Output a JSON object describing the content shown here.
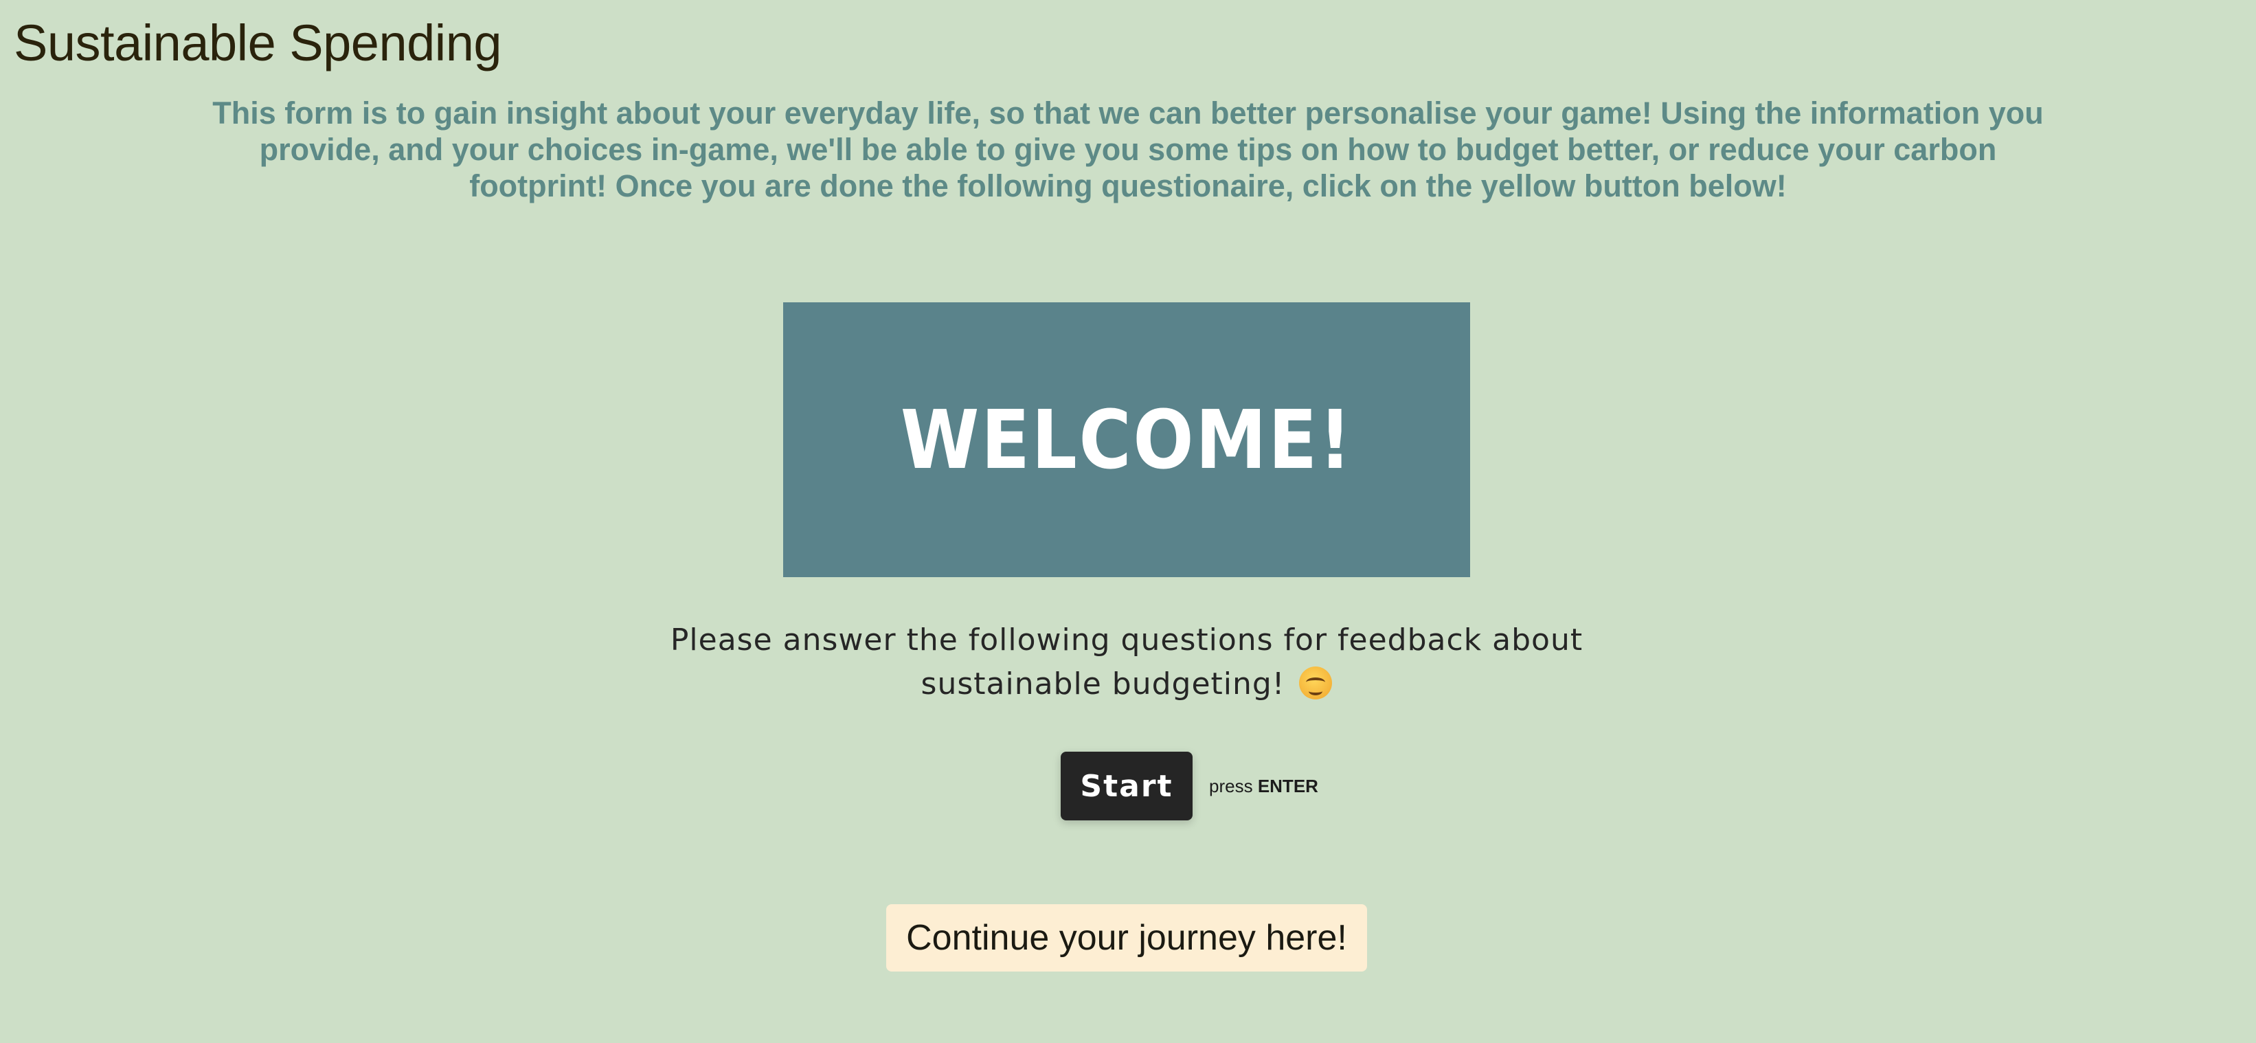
{
  "page": {
    "title": "Sustainable Spending",
    "intro": "This form is to gain insight about your everyday life, so that we can better personalise your game! Using the information you provide, and your choices in-game, we'll be able to give you some tips on how to budget better, or reduce your carbon footprint! Once you are done the following questionaire, click on the yellow button below!"
  },
  "form": {
    "welcome_heading": "WELCOME!",
    "question_text": "Please answer the following questions for feedback about sustainable budgeting!",
    "emoji": "hugging-face-icon",
    "start_label": "Start",
    "press_prefix": "press",
    "press_key": "ENTER"
  },
  "continue": {
    "label": "Continue your journey here!"
  },
  "colors": {
    "background": "#cddfc7",
    "title": "#2a230c",
    "intro_text": "#5d8a87",
    "welcome_banner": "#5a838b",
    "start_button": "#252525",
    "continue_button": "#fdeed3"
  }
}
